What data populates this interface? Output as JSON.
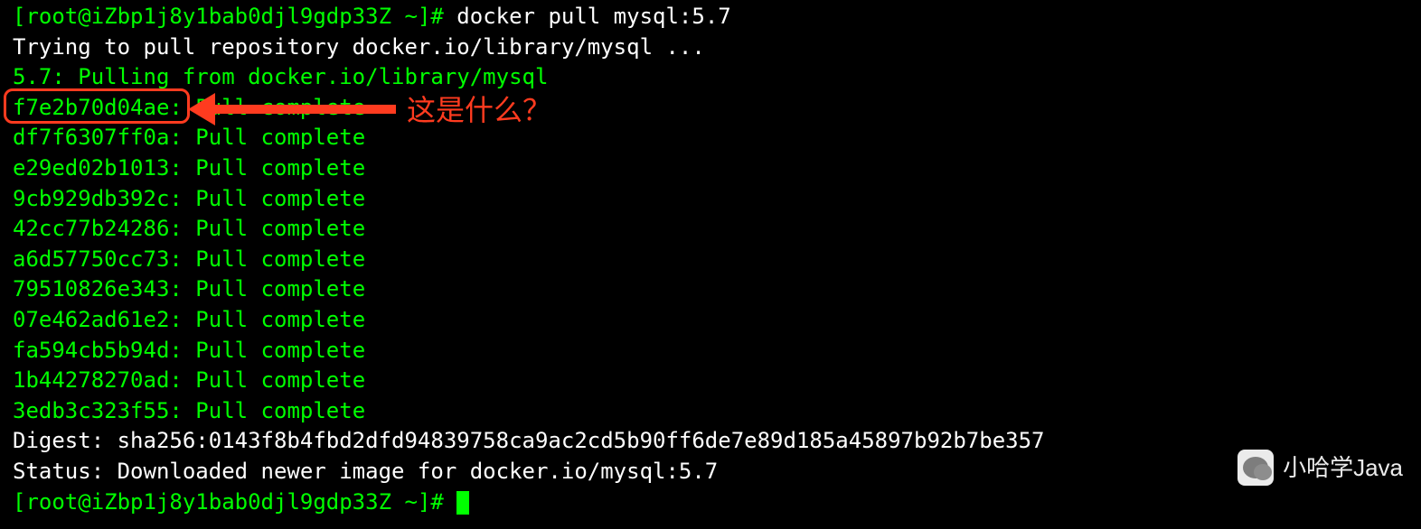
{
  "prompt1": {
    "bracket_open": "[",
    "user_host": "root@iZbp1j8y1bab0djl9gdp33Z ~",
    "bracket_close": "]#",
    "command": " docker pull mysql:5.7"
  },
  "lines": {
    "trying": "Trying to pull repository docker.io/library/mysql ...",
    "pulling": "5.7: Pulling from docker.io/library/mysql",
    "layers": [
      {
        "hash": "f7e2b70d04ae",
        "status": "Pull complete"
      },
      {
        "hash": "df7f6307ff0a",
        "status": "Pull complete"
      },
      {
        "hash": "e29ed02b1013",
        "status": "Pull complete"
      },
      {
        "hash": "9cb929db392c",
        "status": "Pull complete"
      },
      {
        "hash": "42cc77b24286",
        "status": "Pull complete"
      },
      {
        "hash": "a6d57750cc73",
        "status": "Pull complete"
      },
      {
        "hash": "79510826e343",
        "status": "Pull complete"
      },
      {
        "hash": "07e462ad61e2",
        "status": "Pull complete"
      },
      {
        "hash": "fa594cb5b94d",
        "status": "Pull complete"
      },
      {
        "hash": "1b44278270ad",
        "status": "Pull complete"
      },
      {
        "hash": "3edb3c323f55",
        "status": "Pull complete"
      }
    ],
    "digest": "Digest: sha256:0143f8b4fbd2dfd94839758ca9ac2cd5b90ff6de7e89d185a45897b92b7be357",
    "status": "Status: Downloaded newer image for docker.io/mysql:5.7"
  },
  "prompt2": {
    "bracket_open": "[",
    "user_host": "root@iZbp1j8y1bab0djl9gdp33Z ~",
    "bracket_close": "]#",
    "trailing": " "
  },
  "annotation": {
    "text": "这是什么？"
  },
  "watermark": {
    "text": "小哈学Java"
  }
}
